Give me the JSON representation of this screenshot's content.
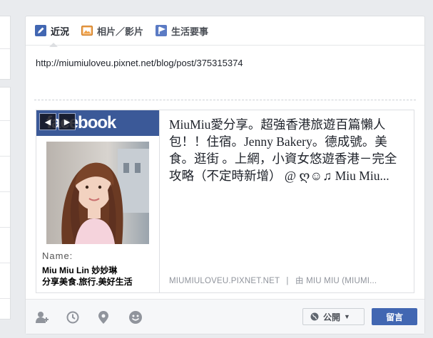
{
  "composer": {
    "tabs": [
      {
        "label": "近況",
        "icon": "pencil-icon"
      },
      {
        "label": "相片／影片",
        "icon": "photo-icon"
      },
      {
        "label": "生活要事",
        "icon": "flag-icon"
      }
    ],
    "text": "http://miumiuloveu.pixnet.net/blog/post/375315374"
  },
  "preview": {
    "brand": "facebook",
    "name_label": "Name:",
    "name_value": "Miu Miu Lin 妙妙琳",
    "desc_value": "分享美食.旅行.美好生活",
    "title": "MiuMiu愛分享。超強香港旅遊百篇懶人包！！住宿。Jenny Bakery。德成號。美食。逛街 。上網，小資女悠遊香港－完全攻略（不定時新增） @ ღ☺♫ Miu Miu...",
    "domain": "MIUMIULOVEU.PIXNET.NET",
    "separator": "|",
    "by": "由 MIU MIU (MIUMI..."
  },
  "footer": {
    "icons": [
      "tag-friends-icon",
      "clock-icon",
      "location-pin-icon",
      "feeling-smiley-icon"
    ],
    "audience_label": "公開",
    "post_label": "留言"
  },
  "colors": {
    "brand_blue": "#3b5998",
    "button_blue": "#4267b2",
    "page_bg": "#e9ebee"
  }
}
